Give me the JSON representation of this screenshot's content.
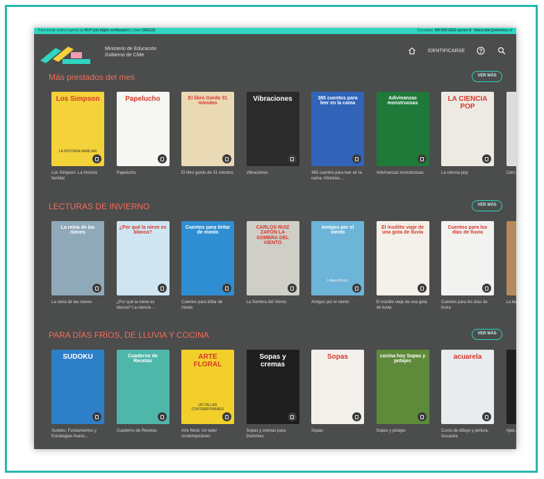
{
  "topbar": {
    "left_prefix": "Para iniciar sesión ingrese su",
    "left_rut": "RUT (sin dígito verificador)",
    "left_mid": "y clave",
    "left_clave": "CRA123",
    "right_prefix": "Consultas:",
    "right_phone": "600 600 2626 opción 8",
    "right_email": "bdescolar@mineduc.cl"
  },
  "header": {
    "ministry_line1": "Ministerio de Educación",
    "ministry_line2": "Gobierno de Chile",
    "identify_label": "IDENTIFICARSE",
    "icons": [
      "home-icon",
      "help-icon",
      "search-icon"
    ]
  },
  "colors": {
    "accent": "#2fd6c2",
    "section_title": "#f26d5b",
    "background": "#4b4c4c",
    "frame": "#27b6b0"
  },
  "sections": [
    {
      "title": "Más prestados del mes",
      "more_label": "VER MÁS",
      "books": [
        {
          "title": "Los Simpson. La historia familiar",
          "cover_text": "Los Simpson",
          "cover_sub": "LA HISTORIA FAMILIAR",
          "color": "#f4d23a"
        },
        {
          "title": "Papelucho",
          "cover_text": "Papelucho",
          "cover_sub": "",
          "color": "#f6f6f3"
        },
        {
          "title": "El libro gordo de 31 minutos",
          "cover_text": "El libro Gordo 31 minutos",
          "cover_sub": "",
          "color": "#e9d9b5"
        },
        {
          "title": "Vibraciones",
          "cover_text": "Vibraciones",
          "cover_sub": "",
          "color": "#2b2b2b"
        },
        {
          "title": "365 cuentos para leer en la cama. Historias ...",
          "cover_text": "365 cuentos para leer en la cama",
          "cover_sub": "",
          "color": "#3164b8"
        },
        {
          "title": "Adivinanzas monstruosas",
          "cover_text": "Adivinanzas monstruosas",
          "cover_sub": "",
          "color": "#1f7a3a"
        },
        {
          "title": "La ciencia pop",
          "cover_text": "LA CIENCIA POP",
          "cover_sub": "",
          "color": "#eceae2"
        },
        {
          "title": "Cóm... comp...",
          "cover_text": "",
          "cover_sub": "",
          "color": "#dcdcdc"
        }
      ]
    },
    {
      "title": "LECTURAS DE INVIERNO",
      "more_label": "VER MÁS",
      "books": [
        {
          "title": "La reina de las nieves",
          "cover_text": "La reina de las nieves",
          "cover_sub": "",
          "color": "#8fa9b8"
        },
        {
          "title": "¿Por qué la nieve es blanca? La ciencia ...",
          "cover_text": "¿Por qué la nieve es blanca?",
          "cover_sub": "",
          "color": "#cfe6f2"
        },
        {
          "title": "Cuentos para tiritar de miedo",
          "cover_text": "Cuentos para tiritar de miedo",
          "cover_sub": "",
          "color": "#2f8ed1"
        },
        {
          "title": "La Sombra del Viento",
          "cover_text": "CARLOS RUIZ ZAFÓN LA SOMBRA DEL VIENTO",
          "cover_sub": "",
          "color": "#cfcfc8"
        },
        {
          "title": "Amigos por el viento",
          "cover_text": "Amigos por el viento",
          "cover_sub": "Liliana Bodoc",
          "color": "#6cb4d8"
        },
        {
          "title": "El insólito viaje de una gota de lluvia",
          "cover_text": "El insólito viaje de una gota de lluvia",
          "cover_sub": "",
          "color": "#f4f1ea"
        },
        {
          "title": "Cuentos para los días de lluvia",
          "cover_text": "Cuentos para los días de lluvia",
          "cover_sub": "",
          "color": "#f2f2f0"
        },
        {
          "title": "La bu... cuán...",
          "cover_text": "",
          "cover_sub": "",
          "color": "#b58a5c"
        }
      ]
    },
    {
      "title": "PARA DÍAS FRÍOS, DE LLUVIA Y COCINA",
      "more_label": "VER MÁS",
      "books": [
        {
          "title": "Sudoku: Fundamentos y Estrategias Avanz...",
          "cover_text": "SUDOKU",
          "cover_sub": "",
          "color": "#2d7fc8"
        },
        {
          "title": "Cuaderno de Recetas",
          "cover_text": "Cuaderno de Recetas",
          "cover_sub": "",
          "color": "#4fb6aa"
        },
        {
          "title": "Arte floral. Un taller contemporáneo",
          "cover_text": "ARTE FLORAL",
          "cover_sub": "UN TALLER CONTEMPORÁNEO",
          "color": "#f2cf2a"
        },
        {
          "title": "Sopas y cremas para Dummies",
          "cover_text": "Sopas y cremas",
          "cover_sub": "",
          "color": "#1e1e1e"
        },
        {
          "title": "Sopas",
          "cover_text": "Sopas",
          "cover_sub": "",
          "color": "#f3f0ec"
        },
        {
          "title": "Sopas y potajes",
          "cover_text": "cocina hoy Sopas y potajes",
          "cover_sub": "",
          "color": "#5e8b3a"
        },
        {
          "title": "Curso de dibujo y pintura. Acuarela",
          "cover_text": "acuarela",
          "cover_sub": "",
          "color": "#e9ecef"
        },
        {
          "title": "Ajed...",
          "cover_text": "",
          "cover_sub": "",
          "color": "#1f1f1f"
        }
      ]
    }
  ]
}
